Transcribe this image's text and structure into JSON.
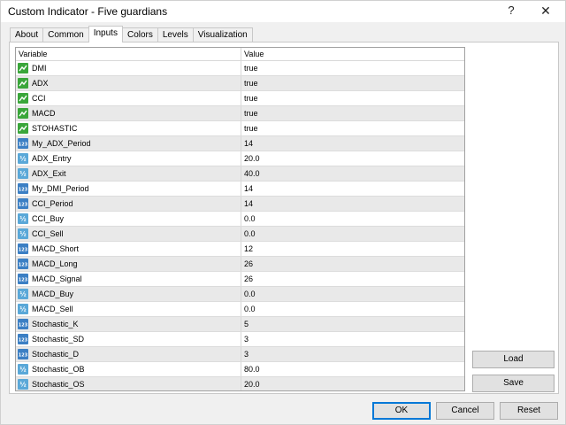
{
  "window": {
    "title": "Custom Indicator - Five guardians",
    "help_glyph": "?",
    "close_glyph": "✕"
  },
  "tabs": [
    {
      "label": "About"
    },
    {
      "label": "Common"
    },
    {
      "label": "Inputs"
    },
    {
      "label": "Colors"
    },
    {
      "label": "Levels"
    },
    {
      "label": "Visualization"
    }
  ],
  "active_tab": "Inputs",
  "grid": {
    "headers": {
      "variable": "Variable",
      "value": "Value"
    },
    "rows": [
      {
        "name": "DMI",
        "value": "true",
        "type": "bool"
      },
      {
        "name": "ADX",
        "value": "true",
        "type": "bool"
      },
      {
        "name": "CCI",
        "value": "true",
        "type": "bool"
      },
      {
        "name": "MACD",
        "value": "true",
        "type": "bool"
      },
      {
        "name": "STOHASTIC",
        "value": "true",
        "type": "bool"
      },
      {
        "name": "My_ADX_Period",
        "value": "14",
        "type": "int"
      },
      {
        "name": "ADX_Entry",
        "value": "20.0",
        "type": "double"
      },
      {
        "name": "ADX_Exit",
        "value": "40.0",
        "type": "double"
      },
      {
        "name": "My_DMI_Period",
        "value": "14",
        "type": "int"
      },
      {
        "name": "CCI_Period",
        "value": "14",
        "type": "int"
      },
      {
        "name": "CCI_Buy",
        "value": "0.0",
        "type": "double"
      },
      {
        "name": "CCI_Sell",
        "value": "0.0",
        "type": "double"
      },
      {
        "name": "MACD_Short",
        "value": "12",
        "type": "int"
      },
      {
        "name": "MACD_Long",
        "value": "26",
        "type": "int"
      },
      {
        "name": "MACD_Signal",
        "value": "26",
        "type": "int"
      },
      {
        "name": "MACD_Buy",
        "value": "0.0",
        "type": "double"
      },
      {
        "name": "MACD_Sell",
        "value": "0.0",
        "type": "double"
      },
      {
        "name": "Stochastic_K",
        "value": "5",
        "type": "int"
      },
      {
        "name": "Stochastic_SD",
        "value": "3",
        "type": "int"
      },
      {
        "name": "Stochastic_D",
        "value": "3",
        "type": "int"
      },
      {
        "name": "Stochastic_OB",
        "value": "80.0",
        "type": "double"
      },
      {
        "name": "Stochastic_OS",
        "value": "20.0",
        "type": "double"
      }
    ]
  },
  "icons": {
    "bool": {
      "name": "bool-type-icon",
      "color": "#3aa63a"
    },
    "int": {
      "name": "integer-type-icon",
      "color": "#3b7fc4",
      "glyph": "123"
    },
    "double": {
      "name": "double-type-icon",
      "color": "#5aa8d8",
      "glyph": "½"
    }
  },
  "side_buttons": {
    "load": "Load",
    "save": "Save"
  },
  "footer_buttons": {
    "ok": "OK",
    "cancel": "Cancel",
    "reset": "Reset"
  },
  "colors": {
    "accent": "#0078d7",
    "row_alt": "#e9e9e9"
  }
}
